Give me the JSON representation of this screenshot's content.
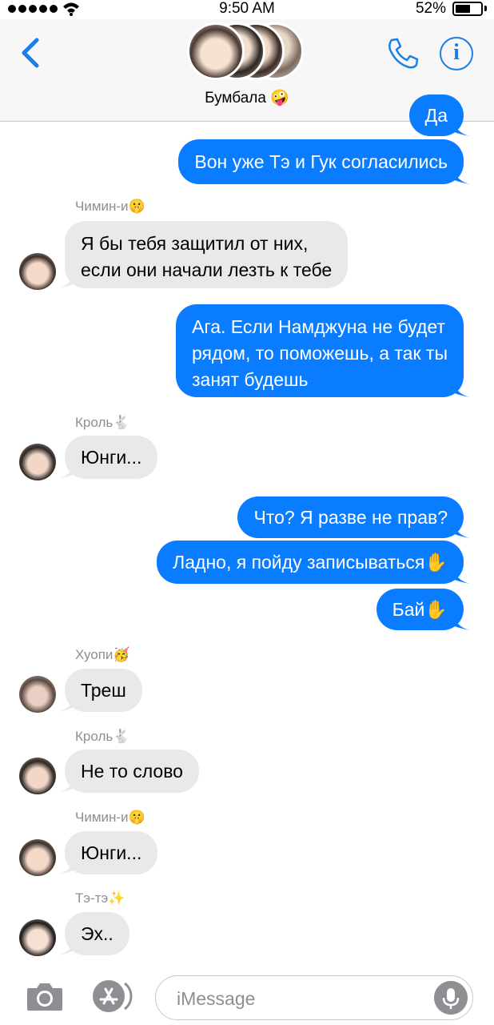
{
  "status_bar": {
    "time": "9:50 AM",
    "battery": "52%",
    "battery_level": 0.52
  },
  "header": {
    "group_name": "Бумбала 🤪"
  },
  "messages": [
    {
      "dir": "out",
      "text": "Да"
    },
    {
      "dir": "out",
      "text": "Вон уже Тэ и Гук согласились"
    },
    {
      "dir": "in",
      "sender": "Чимин-и🤫",
      "text": "Я бы тебя защитил от них,\nесли они начали лезть к тебе"
    },
    {
      "dir": "out",
      "text": "Ага. Если Намджуна не будет\nрядом, то поможешь, а так ты\nзанят будешь"
    },
    {
      "dir": "in",
      "sender": "Кроль🐇",
      "text": "Юнги..."
    },
    {
      "dir": "out",
      "text": "Что? Я разве не прав?"
    },
    {
      "dir": "out",
      "text": "Ладно, я пойду записываться✋"
    },
    {
      "dir": "out",
      "text": "Бай✋"
    },
    {
      "dir": "in",
      "sender": "Хуопи🥳",
      "text": "Треш"
    },
    {
      "dir": "in",
      "sender": "Кроль🐇",
      "text": "Не то слово"
    },
    {
      "dir": "in",
      "sender": "Чимин-и🤫",
      "text": "Юнги..."
    },
    {
      "dir": "in",
      "sender": "Тэ-тэ✨",
      "text": "Эх.."
    }
  ],
  "input": {
    "placeholder": "iMessage"
  },
  "colors": {
    "accent": "#1a7fe6",
    "outgoing": "#0a7cff",
    "incoming": "#e9e9eb",
    "meta": "#8e8e93"
  },
  "icons": [
    "back-chevron-icon",
    "phone-icon",
    "info-icon",
    "camera-icon",
    "app-store-icon",
    "microphone-icon"
  ]
}
